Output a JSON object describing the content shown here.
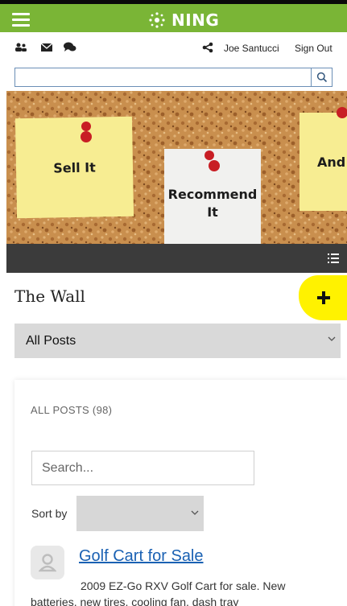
{
  "header": {
    "logo_text": "NING",
    "brand_color": "#7ab536"
  },
  "userbar": {
    "user_name": "Joe Santucci",
    "sign_out_label": "Sign Out",
    "icons": [
      "members-icon",
      "mail-icon",
      "chat-icon",
      "share-icon"
    ]
  },
  "search_top": {
    "placeholder": "",
    "value": ""
  },
  "banner": {
    "notes": [
      "Sell It",
      "Recommend It",
      "And"
    ]
  },
  "wall": {
    "title": "The Wall",
    "filter_selected": "All Posts",
    "add_button_highlight": "#fff200"
  },
  "posts_panel": {
    "count_label": "ALL POSTS (98)",
    "search_placeholder": "Search...",
    "sort_label": "Sort by",
    "sort_selected": ""
  },
  "posts": [
    {
      "title": "Golf Cart for Sale",
      "excerpt": "2009 EZ-Go RXV Golf Cart for sale.  New batteries, new tires, cooling fan, dash tray"
    }
  ]
}
